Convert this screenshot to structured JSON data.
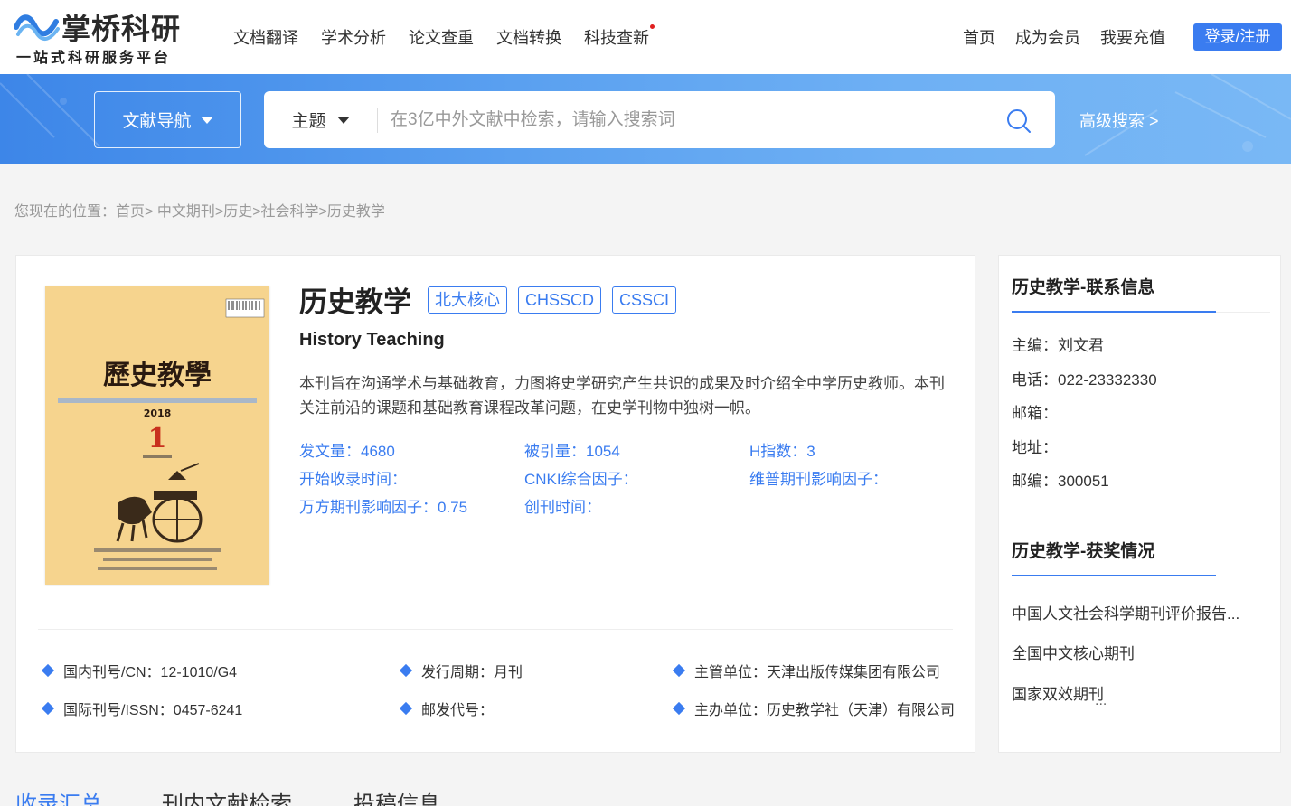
{
  "brand": {
    "name": "掌桥科研",
    "slogan": "一站式科研服务平台",
    "accent_color": "#3a7cf0",
    "logo_icon": "wave-logo-icon"
  },
  "nav": {
    "items": [
      "文档翻译",
      "学术分析",
      "论文查重",
      "文档转换",
      "科技查新"
    ],
    "right_items": [
      "首页",
      "成为会员",
      "我要充值"
    ],
    "login_label": "登录/注册"
  },
  "search": {
    "nav_dropdown_label": "文献导航",
    "type_label": "主题",
    "placeholder": "在3亿中外文献中检索，请输入搜索词",
    "advanced_label": "高级搜索  >",
    "icon": "search-icon"
  },
  "breadcrumb": {
    "prefix": "您现在的位置：",
    "items": [
      "首页>",
      "中文期刊>",
      "历史>",
      "社会科学>",
      "历史教学"
    ]
  },
  "journal": {
    "title": "历史教学",
    "english_title": "History Teaching",
    "tags": [
      "北大核心",
      "CHSSCD",
      "CSSCI"
    ],
    "description": "本刊旨在沟通学术与基础教育，力图将史学研究产生共识的成果及时介绍全中学历史教师。本刊关注前沿的课题和基础教育课程改革问题，在史学刊物中独树一帜。",
    "cover": {
      "title": "歷史教學",
      "year": "2018",
      "issue": "1"
    },
    "stats": [
      "发文量：4680",
      "被引量：1054",
      "H指数：3",
      "开始收录时间：",
      "CNKI综合因子：",
      "维普期刊影响因子：",
      "万方期刊影响因子：0.75",
      "创刊时间："
    ],
    "info": [
      [
        "国内刊号/CN：12-1010/G4",
        "发行周期：月刊",
        "主管单位：天津出版传媒集团有限公司"
      ],
      [
        "国际刊号/ISSN：0457-6241",
        "邮发代号：",
        "主办单位：历史教学社（天津）有限公司"
      ]
    ]
  },
  "sidebar": {
    "contact_title": "历史教学-联系信息",
    "contact": [
      "主编：刘文君",
      "电话：022-23332330",
      "邮箱：",
      "地址：",
      "邮编：300051"
    ],
    "awards_title": "历史教学-获奖情况",
    "awards": [
      "中国人文社会科学期刊评价报告...",
      "全国中文核心期刊",
      "国家双效期刊"
    ],
    "more": "..."
  },
  "tabs": [
    "收录汇总",
    "刊内文献检索",
    "投稿信息"
  ]
}
